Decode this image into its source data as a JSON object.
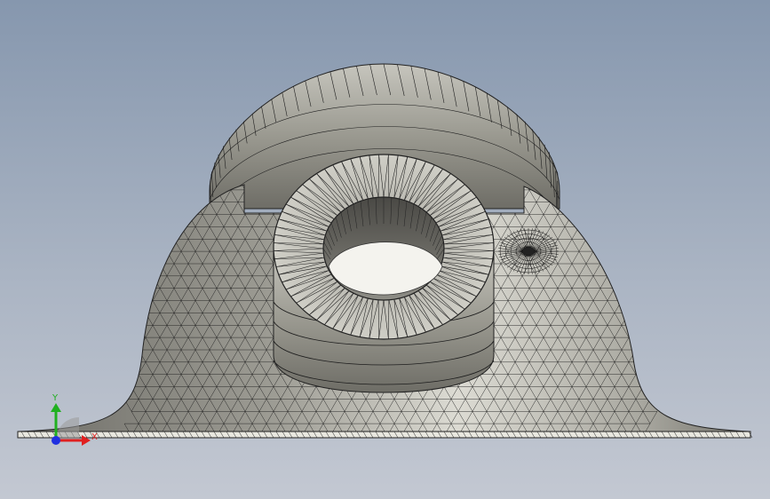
{
  "viewport": {
    "background_top": "#8697ae",
    "background_bottom": "#c3c8d2"
  },
  "model": {
    "type": "pillow-block-bearing-housing",
    "display_mode": "shaded-with-mesh-edges",
    "surface_color": "#c9c8c0",
    "mesh_color": "#1e1e1e"
  },
  "triad": {
    "x_label": "X",
    "y_label": "Y",
    "x_color": "#e02020",
    "y_color": "#20b020",
    "z_color": "#2030e0"
  }
}
